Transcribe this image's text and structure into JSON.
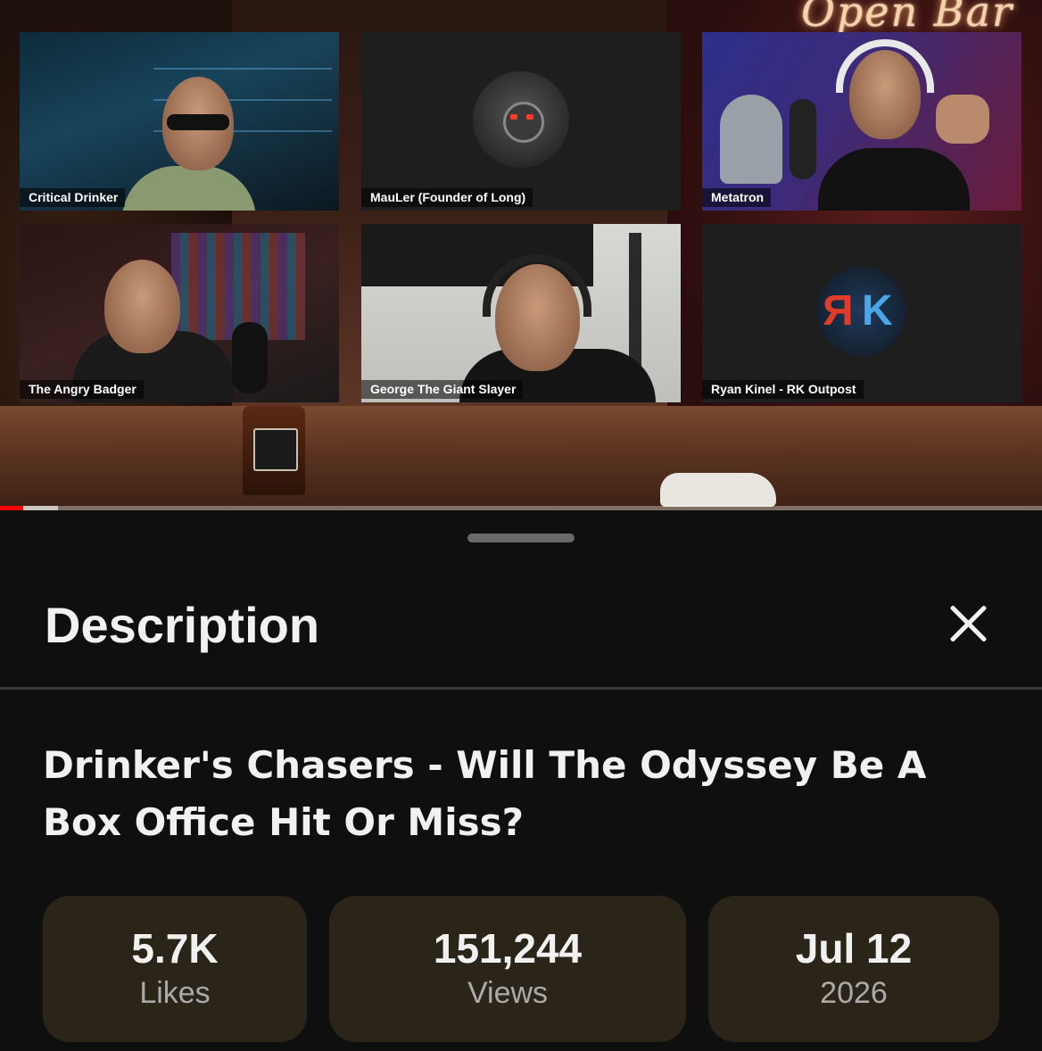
{
  "video": {
    "sign_text": "Open Bar",
    "progress_fraction": 0.022,
    "buffer_fraction": 0.055,
    "participants": [
      {
        "name": "Critical Drinker"
      },
      {
        "name": "MauLer (Founder of Long)"
      },
      {
        "name": "Metatron"
      },
      {
        "name": "The Angry Badger"
      },
      {
        "name": "George The Giant Slayer"
      },
      {
        "name": "Ryan Kinel - RK Outpost"
      }
    ],
    "rk_logo": {
      "left": "R",
      "right": "K"
    }
  },
  "sheet": {
    "heading": "Description",
    "close_icon": "close-icon",
    "video_title": "Drinker's Chasers - Will The Odyssey Be A Box Office Hit Or Miss?",
    "stats": {
      "likes_value": "5.7K",
      "likes_label": "Likes",
      "views_value": "151,244",
      "views_label": "Views",
      "date_value": "Jul 12",
      "date_label": "2026"
    }
  },
  "colors": {
    "background": "#0f0f0f",
    "stat_card": "#2a2518",
    "progress": "#ff0000",
    "text_primary": "#f1f1f1",
    "text_secondary": "#aaaaaa"
  }
}
